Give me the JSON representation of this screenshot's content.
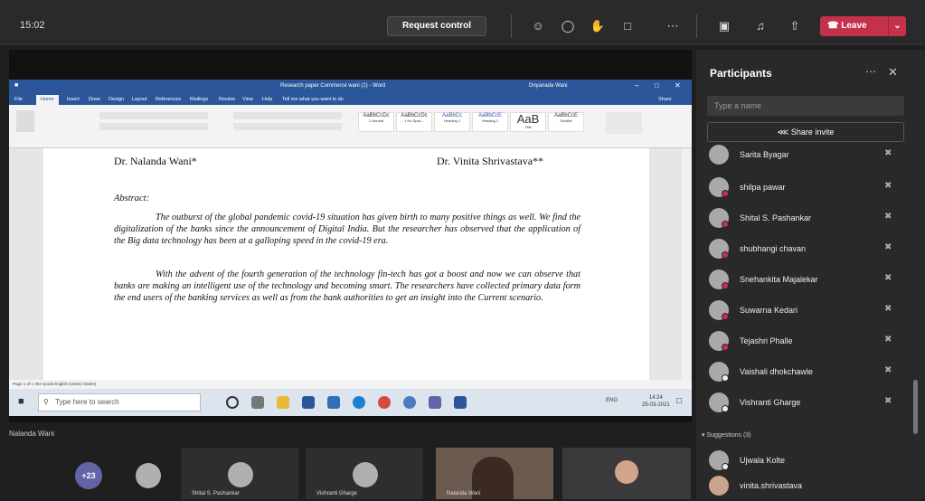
{
  "topbar": {
    "time": "15:02",
    "request_control": "Request control",
    "leave": "Leave",
    "icons": [
      "participants-icon",
      "chat-icon",
      "reactions-icon",
      "rooms-icon",
      "more-icon",
      "camera-off-icon",
      "mic-off-icon",
      "share-icon"
    ]
  },
  "word": {
    "title": "Research paper Commerce wani (1) - Word",
    "user": "Dnyanada Wani",
    "tabs": [
      "File",
      "Home",
      "Insert",
      "Draw",
      "Design",
      "Layout",
      "References",
      "Mailings",
      "Review",
      "View",
      "Help"
    ],
    "tell_me": "Tell me what you want to do",
    "share": "Share",
    "styles": [
      "AaBbCcDc",
      "AaBbCcDc",
      "AaBbCc",
      "AaBbCcE",
      "AaB",
      "AaBbCcE"
    ],
    "style_names": [
      "1 Normal",
      "1 No Spac...",
      "Heading 1",
      "Heading 2",
      "Title",
      "Subtitle"
    ],
    "status": "Page 1 of 1   304 words   English (United States)"
  },
  "document": {
    "author1": "Dr. Nalanda Wani*",
    "author2": "Dr. Vinita Shrivastava**",
    "abstract_heading": "Abstract:",
    "paragraph1": "The outburst of the global pandemic covid-19 situation has given birth to many positive things as well. We find the digitalization of the banks since the announcement of Digital India. But the researcher has observed that the application of the Big data technology has been at a galloping speed in the covid-19 era.",
    "paragraph2": "With the advent of the fourth generation of the technology fin-tech has got a boost and now we can observe that banks are making an intelligent use of the technology and becoming smart. The researchers have collected primary data form the end users of the banking services as well as from the bank authorities to get an insight into the Current scenario."
  },
  "taskbar": {
    "search_placeholder": "Type here to search",
    "time": "14:24",
    "date": "25-03-2021",
    "lang": "ENG"
  },
  "presenter": "Nalanda Wani",
  "gallery": {
    "more_count": "+23",
    "tiles": [
      "Shital S. Pashankar",
      "Vishranti Gharge",
      "Nalanda Wani"
    ]
  },
  "panel": {
    "title": "Participants",
    "search_placeholder": "Type a name",
    "share_invite": "Share invite",
    "participants": [
      "Sarita Byagar",
      "shilpa pawar",
      "Shital S. Pashankar",
      "shubhangi chavan",
      "Snehankita Majalekar",
      "Suwarna Kedari",
      "Tejashri Phalle",
      "Vaishali dhokchawle",
      "Vishranti Gharge"
    ],
    "suggestions_heading": "Suggestions (3)",
    "suggestions": [
      "Ujwala Kolte",
      "vinita.shrivastava"
    ]
  },
  "colors": {
    "leave": "#c4314b",
    "word_blue": "#2b579a",
    "teams_purple": "#6264a7"
  }
}
